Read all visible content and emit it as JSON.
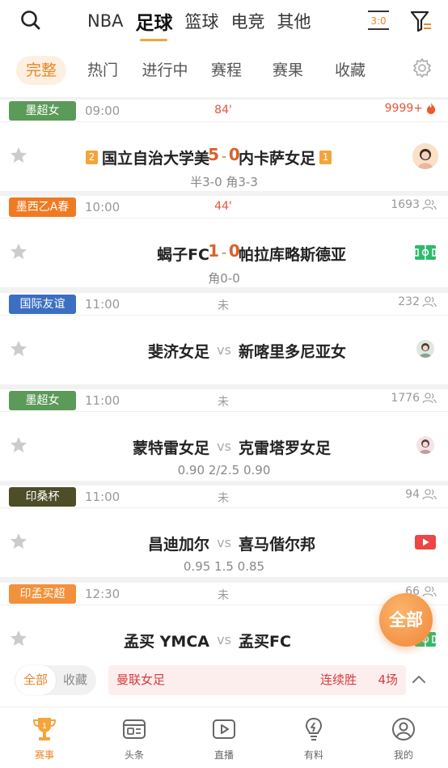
{
  "header": {
    "sports": [
      "NBA",
      "足球",
      "篮球",
      "电竞",
      "其他"
    ],
    "active_sport": "足球",
    "score_icon_text": "3:0"
  },
  "tabs": [
    "完整",
    "热门",
    "进行中",
    "赛程",
    "赛果",
    "收藏"
  ],
  "matches": [
    {
      "league": "墨超女",
      "league_color": "#5b9a58",
      "time": "09:00",
      "status": "84'",
      "count": "9999+",
      "home": "国立自治大学美",
      "home_rank": "2",
      "away": "内卡萨女足",
      "away_rank": "1",
      "home_score": "5",
      "away_score": "0",
      "sub": "半3-0 角3-3"
    },
    {
      "league": "墨西乙A春",
      "league_color": "#f07a22",
      "time": "10:00",
      "status": "44'",
      "count": "1693",
      "home": "蝎子FC",
      "away": "帕拉库略斯德亚",
      "home_score": "1",
      "away_score": "0",
      "sub": "角0-0"
    },
    {
      "league": "国际友谊",
      "league_color": "#3b6fc2",
      "time": "11:00",
      "status": "未",
      "count": "232",
      "home": "斐济女足",
      "vs": "vs",
      "away": "新喀里多尼亚女",
      "sub": ""
    },
    {
      "league": "墨超女",
      "league_color": "#5b9a58",
      "time": "11:00",
      "status": "未",
      "count": "1776",
      "home": "蒙特雷女足",
      "vs": "vs",
      "away": "克雷塔罗女足",
      "sub": "0.90  2/2.5  0.90"
    },
    {
      "league": "印桑杯",
      "league_color": "#4d4d28",
      "time": "11:00",
      "status": "未",
      "count": "94",
      "home": "昌迪加尔",
      "vs": "vs",
      "away": "喜马偕尔邦",
      "sub": "0.95  1.5  0.85"
    },
    {
      "league": "印孟买超",
      "league_color": "#f2913a",
      "time": "12:30",
      "status": "未",
      "count": "66",
      "home": "孟买 YMCA",
      "vs": "vs",
      "away": "孟买FC",
      "sub": ""
    }
  ],
  "bottom_filter": {
    "seg_all": "全部",
    "seg_fav": "收藏",
    "streak_league": "曼联女足",
    "streak_label": "连续胜",
    "streak_count": "4场"
  },
  "fab_label": "全部",
  "bottom_nav": [
    "赛事",
    "头条",
    "直播",
    "有料",
    "我的"
  ],
  "colors": {
    "accent": "#e9862c",
    "live": "#e6563b"
  }
}
